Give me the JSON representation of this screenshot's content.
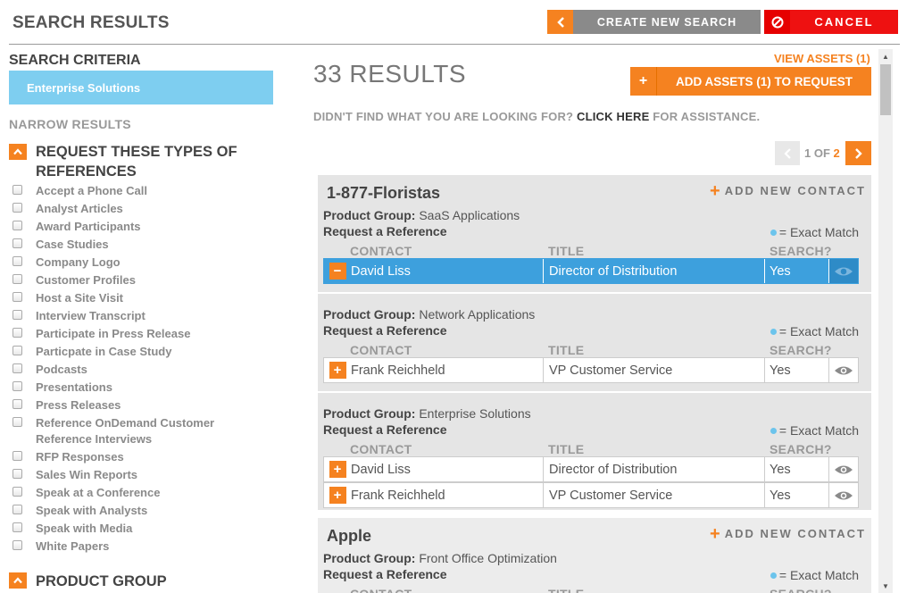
{
  "header": {
    "title": "SEARCH RESULTS",
    "create_label": "CREATE NEW SEARCH",
    "cancel_label": "CANCEL"
  },
  "sidebar": {
    "criteria_title": "SEARCH CRITERIA",
    "criteria_value": "Enterprise Solutions",
    "narrow_title": "NARROW RESULTS",
    "section1_title": "REQUEST THESE TYPES OF REFERENCES",
    "filters": [
      "Accept a Phone Call",
      "Analyst Articles",
      "Award Participants",
      "Case Studies",
      "Company Logo",
      "Customer Profiles",
      "Host a Site Visit",
      "Interview Transcript",
      "Participate in Press Release",
      "Particpate in Case Study",
      "Podcasts",
      "Presentations",
      "Press Releases",
      "Reference OnDemand Customer Reference Interviews",
      "RFP Responses",
      "Sales Win Reports",
      "Speak at a Conference",
      "Speak with Analysts",
      "Speak with Media",
      "White Papers"
    ],
    "section2_title": "PRODUCT GROUP"
  },
  "main": {
    "results_count": "33 RESULTS",
    "view_assets": "VIEW ASSETS (1)",
    "add_assets_label": "ADD ASSETS (1) TO REQUEST",
    "assist_prefix": "DIDN'T FIND WHAT YOU ARE LOOKING FOR?",
    "assist_link": "CLICK HERE",
    "assist_suffix": "FOR ASSISTANCE.",
    "pager": {
      "current": "1",
      "of": "OF",
      "total": "2"
    },
    "add_contact_label": "ADD NEW CONTACT",
    "product_group_label": "Product Group:",
    "request_label": "Request a Reference",
    "exact_label": "= Exact Match",
    "col_contact": "CONTACT",
    "col_title": "TITLE",
    "col_search": "SEARCH?",
    "companies": [
      {
        "name": "1-877-Floristas",
        "groups": [
          {
            "product_group": "SaaS Applications",
            "contacts": [
              {
                "name": "David Liss",
                "title": "Director of Distribution",
                "search": "Yes",
                "selected": true
              }
            ]
          },
          {
            "product_group": "Network Applications",
            "contacts": [
              {
                "name": "Frank Reichheld",
                "title": "VP Customer Service",
                "search": "Yes",
                "selected": false
              }
            ]
          },
          {
            "product_group": "Enterprise Solutions",
            "contacts": [
              {
                "name": "David Liss",
                "title": "Director of Distribution",
                "search": "Yes",
                "selected": false
              },
              {
                "name": "Frank Reichheld",
                "title": "VP Customer Service",
                "search": "Yes",
                "selected": false
              }
            ]
          }
        ]
      },
      {
        "name": "Apple",
        "groups": [
          {
            "product_group": "Front Office Optimization",
            "contacts": []
          }
        ]
      }
    ]
  },
  "colors": {
    "accent_orange": "#f58220",
    "cancel_red": "#ee1111",
    "criteria_blue": "#7ecef0",
    "selected_blue": "#3da0dd"
  }
}
